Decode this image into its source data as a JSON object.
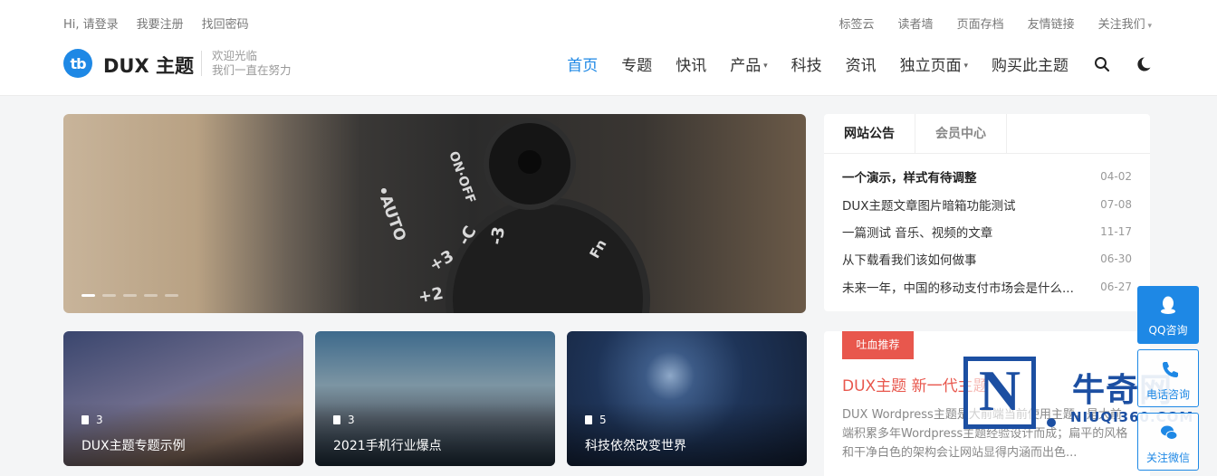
{
  "topbar": {
    "left": [
      "Hi, 请登录",
      "我要注册",
      "找回密码"
    ],
    "right": [
      "标签云",
      "读者墙",
      "页面存档",
      "友情链接",
      "关注我们"
    ]
  },
  "brand": {
    "logo_mark": "tb",
    "name": "DUX 主题",
    "slogan_line1": "欢迎光临",
    "slogan_line2": "我们一直在努力"
  },
  "nav": {
    "items": [
      "首页",
      "专题",
      "快讯",
      "产品",
      "科技",
      "资讯",
      "独立页面",
      "购买此主题"
    ],
    "active_index": 0,
    "dropdown_items": [
      "产品",
      "独立页面"
    ],
    "icons": [
      "search-icon",
      "moon-icon"
    ]
  },
  "slider": {
    "slide_count": 5,
    "active_slide": 1,
    "image_labels": [
      "•AUTO",
      "ON·OFF",
      "+3",
      "+2",
      "-C",
      "-3",
      "Fn"
    ]
  },
  "topic_cards": [
    {
      "count": "3",
      "title": "DUX主题专题示例"
    },
    {
      "count": "3",
      "title": "2021手机行业爆点"
    },
    {
      "count": "5",
      "title": "科技依然改变世界"
    }
  ],
  "notice_widget": {
    "tabs": [
      "网站公告",
      "会员中心"
    ],
    "active_tab": 0,
    "items": [
      {
        "title": "一个演示，样式有待调整",
        "date": "04-02",
        "bold": true
      },
      {
        "title": "DUX主题文章图片暗箱功能测试",
        "date": "07-08",
        "bold": false
      },
      {
        "title": "一篇测试 音乐、视频的文章",
        "date": "11-17",
        "bold": false
      },
      {
        "title": "从下载看我们该如何做事",
        "date": "06-30",
        "bold": false
      },
      {
        "title": "未来一年，中国的移动支付市场会是什么...",
        "date": "06-27",
        "bold": false
      }
    ]
  },
  "recommend_widget": {
    "badge": "吐血推荐",
    "title": "DUX主题 新一代主题",
    "desc": "DUX Wordpress主题是大前端当前使用主题，是大前端积累多年Wordpress主题经验设计而成；扁平的风格和干净白色的架构会让网站显得内涵而出色..."
  },
  "floating_tools": [
    {
      "label": "QQ咨询",
      "icon": "qq-icon"
    },
    {
      "label": "电话咨询",
      "icon": "phone-icon"
    },
    {
      "label": "关注微信",
      "icon": "wechat-icon"
    }
  ],
  "watermark": {
    "letter": "N",
    "cn": "牛奇网",
    "en": "NIUQI360.COM"
  },
  "colors": {
    "accent": "#1e88e5",
    "badge_red": "#e8574d",
    "watermark_blue": "#1c4fa2"
  }
}
